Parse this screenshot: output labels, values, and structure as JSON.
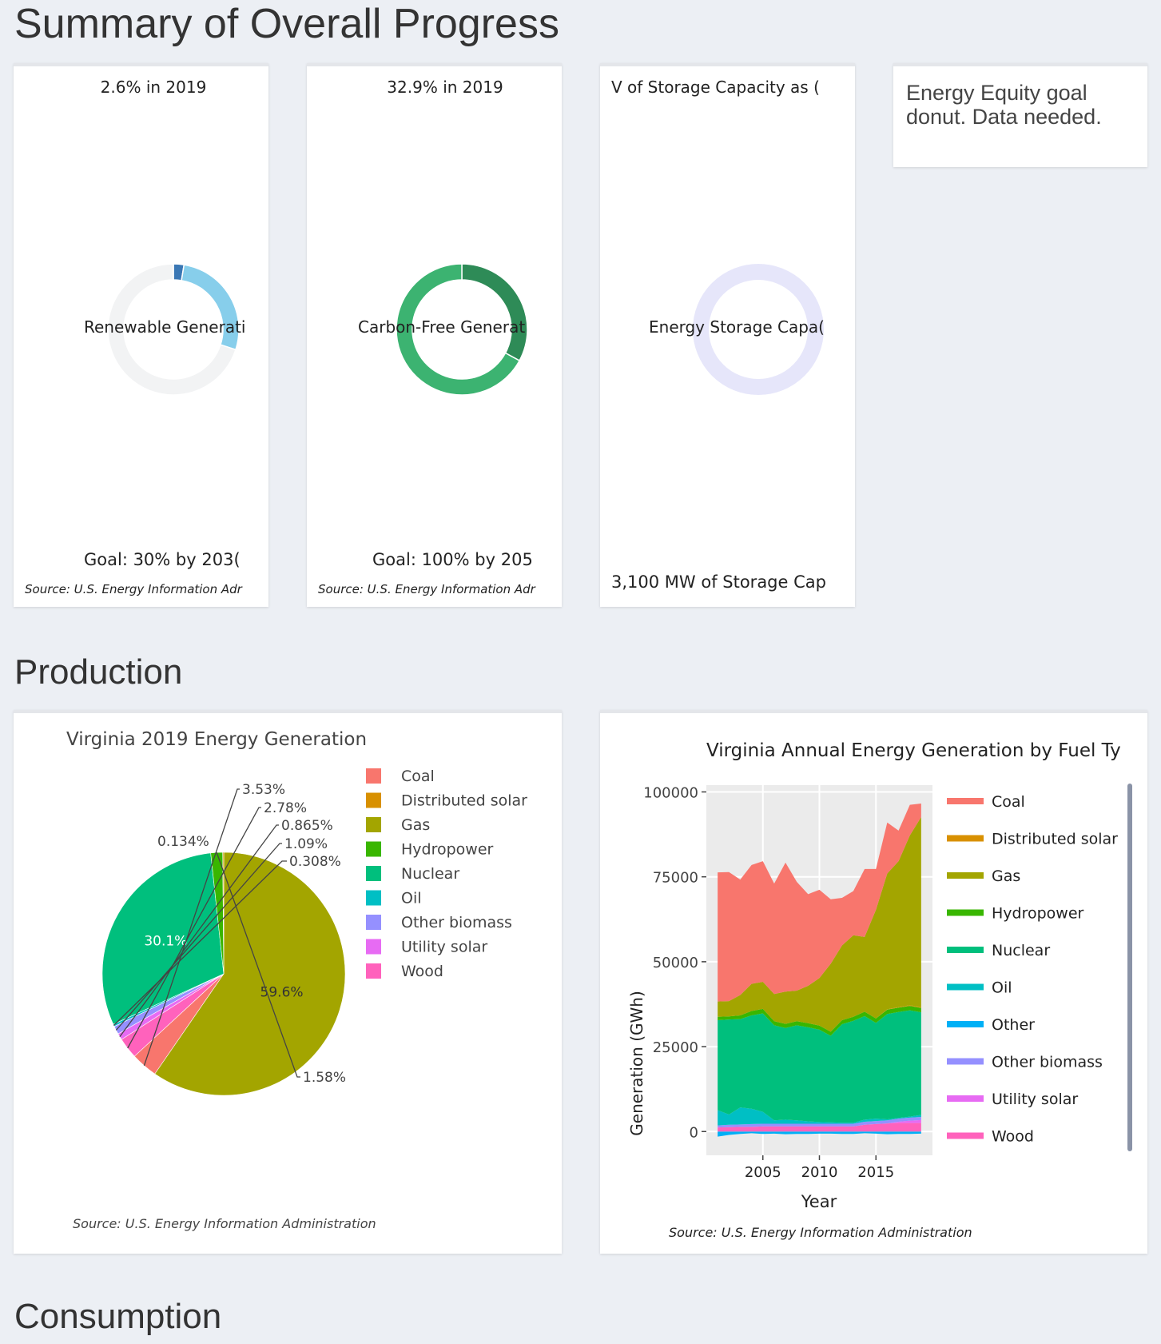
{
  "sections": {
    "summary_title": "Summary of Overall Progress",
    "production_title": "Production",
    "consumption_title": "Consumption"
  },
  "equity_note": "Energy Equity goal donut. Data needed.",
  "colors": {
    "coal": "#f8766d",
    "distributed_solar": "#d89000",
    "gas": "#a3a500",
    "hydropower": "#39b600",
    "nuclear": "#00bf7d",
    "oil": "#00bfc4",
    "other": "#00b0f6",
    "other_biomass": "#9590ff",
    "utility_solar": "#e76bf3",
    "wood": "#ff62bc"
  },
  "chart_data": [
    {
      "type": "pie",
      "variant": "donut",
      "title": "2.6% in 2019",
      "center_label": "Renewable Generati",
      "goal_text": "Goal: 30% by 203(",
      "source": "Source: U.S. Energy Information Adr",
      "slices": [
        {
          "label": "current",
          "value": 2.6,
          "color": "#3a77b4"
        },
        {
          "label": "goal_remaining",
          "value": 27.4,
          "color": "#87ceeb"
        },
        {
          "label": "rest",
          "value": 70.0,
          "color": "#f2f3f4"
        }
      ]
    },
    {
      "type": "pie",
      "variant": "donut",
      "title": "32.9% in 2019",
      "center_label": "Carbon-Free Generat",
      "goal_text": "Goal: 100% by 205",
      "source": "Source: U.S. Energy Information Adr",
      "slices": [
        {
          "label": "current",
          "value": 32.9,
          "color": "#2e8b57"
        },
        {
          "label": "remaining",
          "value": 67.1,
          "color": "#3cb371"
        }
      ]
    },
    {
      "type": "pie",
      "variant": "donut",
      "title": "V of Storage Capacity as (",
      "center_label": "Energy Storage Capa(",
      "goal_text": "3,100 MW of Storage Cap",
      "slices": [
        {
          "label": "remaining",
          "value": 100,
          "color": "#e6e6fa"
        }
      ]
    },
    {
      "type": "pie",
      "title": "Virginia 2019 Energy Generation",
      "source": "Source: U.S. Energy Information Administration",
      "slices": [
        {
          "label": "Gas",
          "value": 59.6,
          "text": "59.6%",
          "key": "gas"
        },
        {
          "label": "Coal",
          "value": 3.53,
          "text": "3.53%",
          "key": "coal"
        },
        {
          "label": "Wood",
          "value": 2.78,
          "text": "2.78%",
          "key": "wood"
        },
        {
          "label": "Utility solar",
          "value": 0.865,
          "text": "0.865%",
          "key": "utility_solar"
        },
        {
          "label": "Other biomass",
          "value": 1.09,
          "text": "1.09%",
          "key": "other_biomass"
        },
        {
          "label": "Oil",
          "value": 0.308,
          "text": "0.308%",
          "key": "oil"
        },
        {
          "label": "Nuclear",
          "value": 30.1,
          "text": "30.1%",
          "key": "nuclear"
        },
        {
          "label": "Hydropower",
          "value": 1.58,
          "text": "1.58%",
          "key": "hydropower"
        },
        {
          "label": "Distributed solar",
          "value": 0.134,
          "text": "0.134%",
          "key": "distributed_solar"
        }
      ],
      "legend": [
        "Coal",
        "Distributed solar",
        "Gas",
        "Hydropower",
        "Nuclear",
        "Oil",
        "Other biomass",
        "Utility solar",
        "Wood"
      ],
      "legend_keys": [
        "coal",
        "distributed_solar",
        "gas",
        "hydropower",
        "nuclear",
        "oil",
        "other_biomass",
        "utility_solar",
        "wood"
      ]
    },
    {
      "type": "area",
      "stacked": true,
      "title": "Virginia Annual Energy Generation by Fuel Ty",
      "xlabel": "Year",
      "ylabel": "Generation (GWh)",
      "source": "Source: U.S. Energy Information Administration",
      "xlim": [
        2000,
        2020
      ],
      "ylim": [
        -7000,
        102000
      ],
      "xticks": [
        2005,
        2010,
        2015
      ],
      "yticks": [
        0,
        25000,
        50000,
        75000,
        100000
      ],
      "ytick_labels": [
        "0",
        "25000",
        "50000",
        "75000",
        "100000"
      ],
      "grid": true,
      "background": "#ebebeb",
      "x": [
        2001,
        2002,
        2003,
        2004,
        2005,
        2006,
        2007,
        2008,
        2009,
        2010,
        2011,
        2012,
        2013,
        2014,
        2015,
        2016,
        2017,
        2018,
        2019
      ],
      "negative_series": {
        "name": "Other",
        "key": "other",
        "values": [
          -1500,
          -1000,
          -700,
          -500,
          -700,
          -600,
          -800,
          -700,
          -700,
          -600,
          -600,
          -700,
          -700,
          -500,
          -600,
          -800,
          -700,
          -700,
          -600
        ]
      },
      "series": [
        {
          "name": "Wood",
          "key": "wood",
          "values": [
            1200,
            1300,
            1400,
            1400,
            1500,
            1500,
            1500,
            1500,
            1500,
            1500,
            1500,
            1500,
            1500,
            2000,
            2200,
            2400,
            2500,
            2500,
            2500
          ]
        },
        {
          "name": "Utility solar",
          "key": "utility_solar",
          "values": [
            0,
            0,
            0,
            0,
            0,
            0,
            0,
            0,
            0,
            0,
            0,
            0,
            0,
            0,
            0,
            0,
            400,
            700,
            900
          ]
        },
        {
          "name": "Other biomass",
          "key": "other_biomass",
          "values": [
            600,
            700,
            700,
            800,
            800,
            800,
            800,
            800,
            800,
            800,
            800,
            800,
            800,
            900,
            900,
            900,
            900,
            900,
            900
          ]
        },
        {
          "name": "Oil",
          "key": "oil",
          "values": [
            4500,
            3000,
            5000,
            4500,
            3500,
            1000,
            1200,
            1000,
            700,
            500,
            400,
            300,
            300,
            600,
            700,
            300,
            200,
            300,
            600
          ]
        },
        {
          "name": "Nuclear",
          "key": "nuclear",
          "values": [
            26500,
            28000,
            26000,
            27500,
            29000,
            28000,
            27000,
            28000,
            27700,
            27200,
            25500,
            29000,
            30000,
            30500,
            28200,
            31000,
            31200,
            31300,
            30200
          ]
        },
        {
          "name": "Hydropower",
          "key": "hydropower",
          "values": [
            1000,
            900,
            1100,
            1300,
            1300,
            1200,
            1200,
            1200,
            1200,
            1200,
            1200,
            1200,
            1200,
            1300,
            1300,
            1300,
            1300,
            1300,
            1300
          ]
        },
        {
          "name": "Distributed solar",
          "key": "distributed_solar",
          "values": [
            0,
            0,
            0,
            0,
            0,
            0,
            0,
            0,
            0,
            0,
            0,
            0,
            0,
            0,
            0,
            100,
            100,
            200,
            200
          ]
        },
        {
          "name": "Gas",
          "key": "gas",
          "values": [
            4500,
            4500,
            6000,
            8000,
            8000,
            8000,
            9500,
            9000,
            11000,
            14000,
            20000,
            22000,
            24000,
            22000,
            32000,
            40000,
            43000,
            50000,
            56000
          ]
        },
        {
          "name": "Coal",
          "key": "coal",
          "values": [
            38000,
            38000,
            34000,
            35000,
            35500,
            32500,
            38000,
            32000,
            27000,
            26000,
            19000,
            14000,
            13000,
            20000,
            12000,
            15000,
            9000,
            9000,
            4000
          ]
        }
      ],
      "legend": [
        "Coal",
        "Distributed solar",
        "Gas",
        "Hydropower",
        "Nuclear",
        "Oil",
        "Other",
        "Other biomass",
        "Utility solar",
        "Wood"
      ],
      "legend_keys": [
        "coal",
        "distributed_solar",
        "gas",
        "hydropower",
        "nuclear",
        "oil",
        "other",
        "other_biomass",
        "utility_solar",
        "wood"
      ]
    }
  ]
}
